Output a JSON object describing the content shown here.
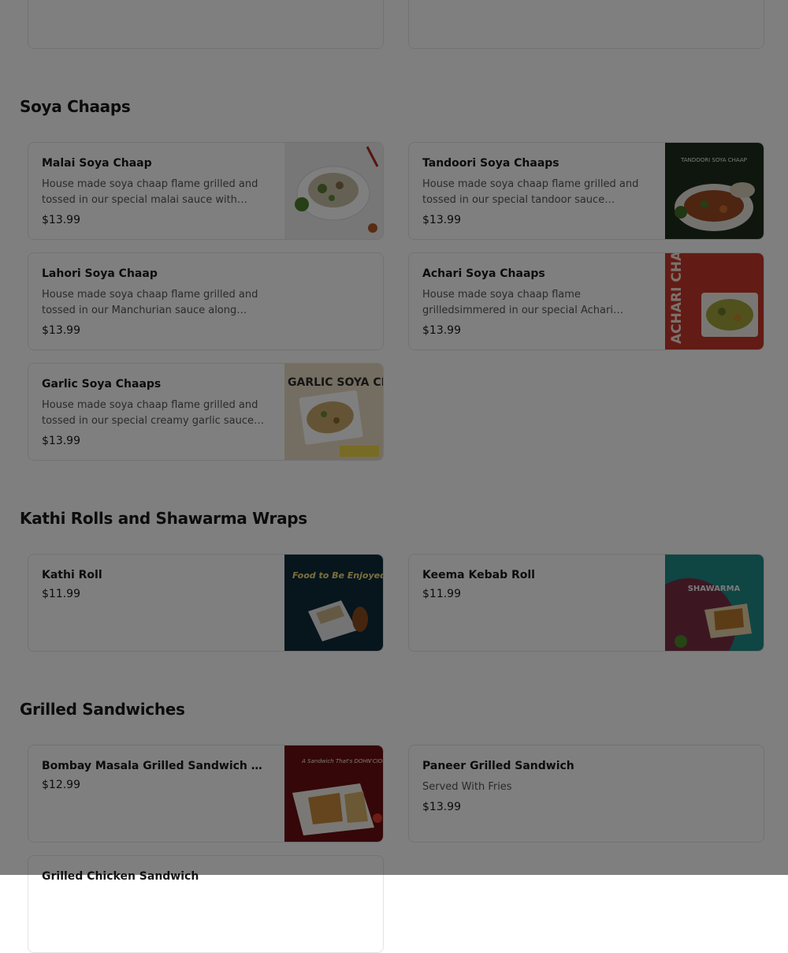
{
  "sections": [
    {
      "title": "Soya Chaaps",
      "items": [
        {
          "name": "Malai Soya Chaap",
          "description": "House made soya chaap flame grilled and tossed in our special malai sauce with…",
          "price": "$13.99"
        },
        {
          "name": "Tandoori Soya Chaaps",
          "description": "House made soya chaap flame grilled and tossed in our special tandoor sauce along…",
          "price": "$13.99"
        },
        {
          "name": "Lahori Soya Chaap",
          "description": "House made soya chaap flame grilled and tossed in our Manchurian sauce along wit…",
          "price": "$13.99"
        },
        {
          "name": "Achari Soya Chaaps",
          "description": "House made soya chaap flame grilledsimmered in our special Achari sauc…",
          "price": "$13.99"
        },
        {
          "name": "Garlic Soya Chaaps",
          "description": "House made soya chaap flame grilled and tossed in our special creamy garlic sauce…",
          "price": "$13.99"
        }
      ]
    },
    {
      "title": "Kathi Rolls and Shawarma Wraps",
      "items": [
        {
          "name": "Kathi Roll",
          "price": "$11.99"
        },
        {
          "name": "Keema Kebab Roll",
          "price": "$11.99"
        }
      ]
    },
    {
      "title": "Grilled Sandwiches",
      "items": [
        {
          "name": "Bombay Masala Grilled Sandwich (Ve…",
          "price": "$12.99"
        },
        {
          "name": "Paneer Grilled Sandwich",
          "description": "Served With Fries",
          "price": "$13.99"
        },
        {
          "name": "Grilled Chicken Sandwich"
        }
      ]
    }
  ],
  "image_text": {
    "tandoori": "TANDOORI SOYA CHAAP",
    "achari": "ACHARI CHAAP",
    "garlic": "GARLIC SOYA CHAAP",
    "kathi": "Food to Be Enjoyed",
    "shawarma": "SHAWARMA",
    "bombay": "A Sandwich That's DOHN'CIOUS"
  },
  "colors": {
    "overlay": "rgba(0,0,0,0.5)",
    "card_border": "#e4e4e4",
    "text": "#191919",
    "muted": "#545454"
  }
}
